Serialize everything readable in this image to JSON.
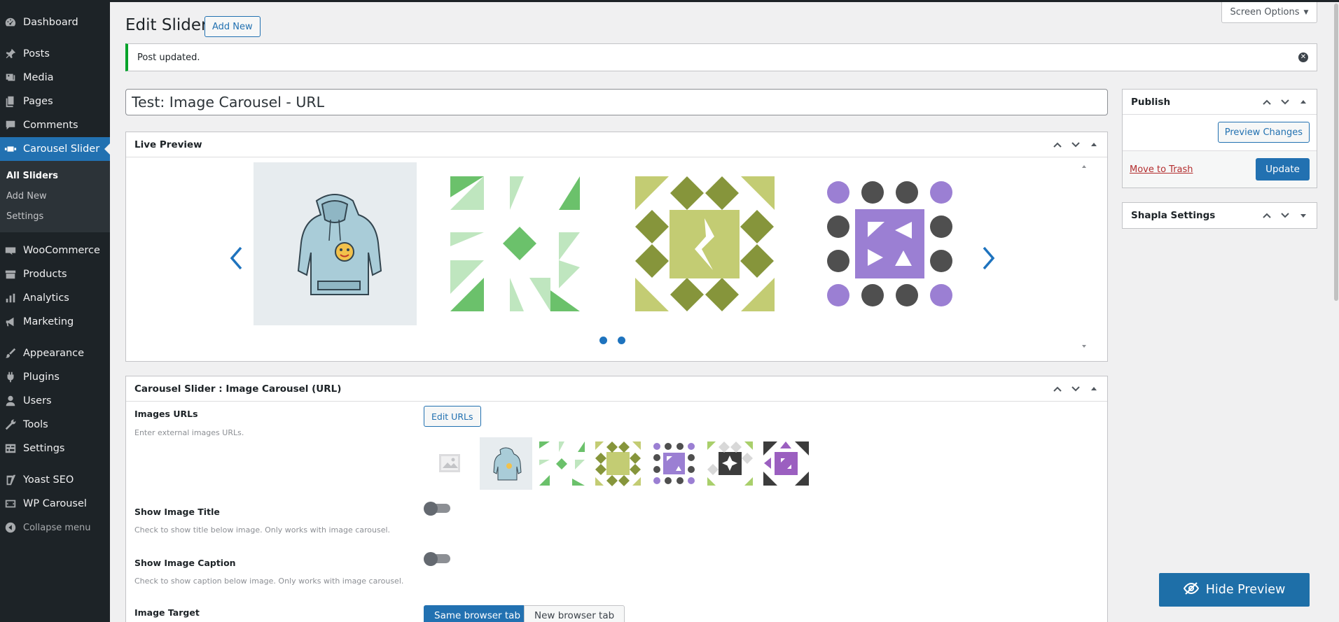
{
  "sidebar": {
    "items": [
      {
        "label": "Dashboard",
        "icon": "dashboard-icon"
      },
      {
        "label": "Posts",
        "icon": "pin-icon"
      },
      {
        "label": "Media",
        "icon": "media-icon"
      },
      {
        "label": "Pages",
        "icon": "pages-icon"
      },
      {
        "label": "Comments",
        "icon": "comments-icon"
      },
      {
        "label": "Carousel Slider",
        "icon": "slides-icon"
      },
      {
        "label": "WooCommerce",
        "icon": "woocommerce-icon"
      },
      {
        "label": "Products",
        "icon": "products-icon"
      },
      {
        "label": "Analytics",
        "icon": "bar-chart-icon"
      },
      {
        "label": "Marketing",
        "icon": "megaphone-icon"
      },
      {
        "label": "Appearance",
        "icon": "brush-icon"
      },
      {
        "label": "Plugins",
        "icon": "plug-icon"
      },
      {
        "label": "Users",
        "icon": "user-icon"
      },
      {
        "label": "Tools",
        "icon": "wrench-icon"
      },
      {
        "label": "Settings",
        "icon": "settings-icon"
      },
      {
        "label": "Yoast SEO",
        "icon": "yoast-icon"
      },
      {
        "label": "WP Carousel",
        "icon": "carousel-icon"
      },
      {
        "label": "Collapse menu",
        "icon": "collapse-icon"
      }
    ],
    "submenu": [
      "All Sliders",
      "Add New",
      "Settings"
    ]
  },
  "header": {
    "title": "Edit Slider",
    "add_new": "Add New",
    "screen_options": "Screen Options"
  },
  "notice": {
    "text": "Post updated."
  },
  "post_title": "Test: Image Carousel - URL",
  "live_preview": {
    "title": "Live Preview",
    "pages": 2
  },
  "carousel_box": {
    "title": "Carousel Slider : Image Carousel (URL)",
    "images_urls_label": "Images URLs",
    "images_urls_desc": "Enter external images URLs.",
    "edit_urls": "Edit URLs",
    "show_title_label": "Show Image Title",
    "show_title_desc": "Check to show title below image. Only works with image carousel.",
    "show_title_enabled": false,
    "show_caption_label": "Show Image Caption",
    "show_caption_desc": "Check to show caption below image. Only works with image carousel.",
    "show_caption_enabled": false,
    "target_label": "Image Target",
    "target_options": [
      "Same browser tab",
      "New browser tab"
    ],
    "target_selected": "Same browser tab"
  },
  "publish": {
    "title": "Publish",
    "preview_changes": "Preview Changes",
    "move_to_trash": "Move to Trash",
    "update": "Update"
  },
  "shapla": {
    "title": "Shapla Settings"
  },
  "hide_preview": "Hide Preview",
  "colors": {
    "accent": "#2271b1",
    "admin_bar": "#1d2327",
    "notice_success": "#00a32a",
    "trash": "#b32d2e"
  }
}
